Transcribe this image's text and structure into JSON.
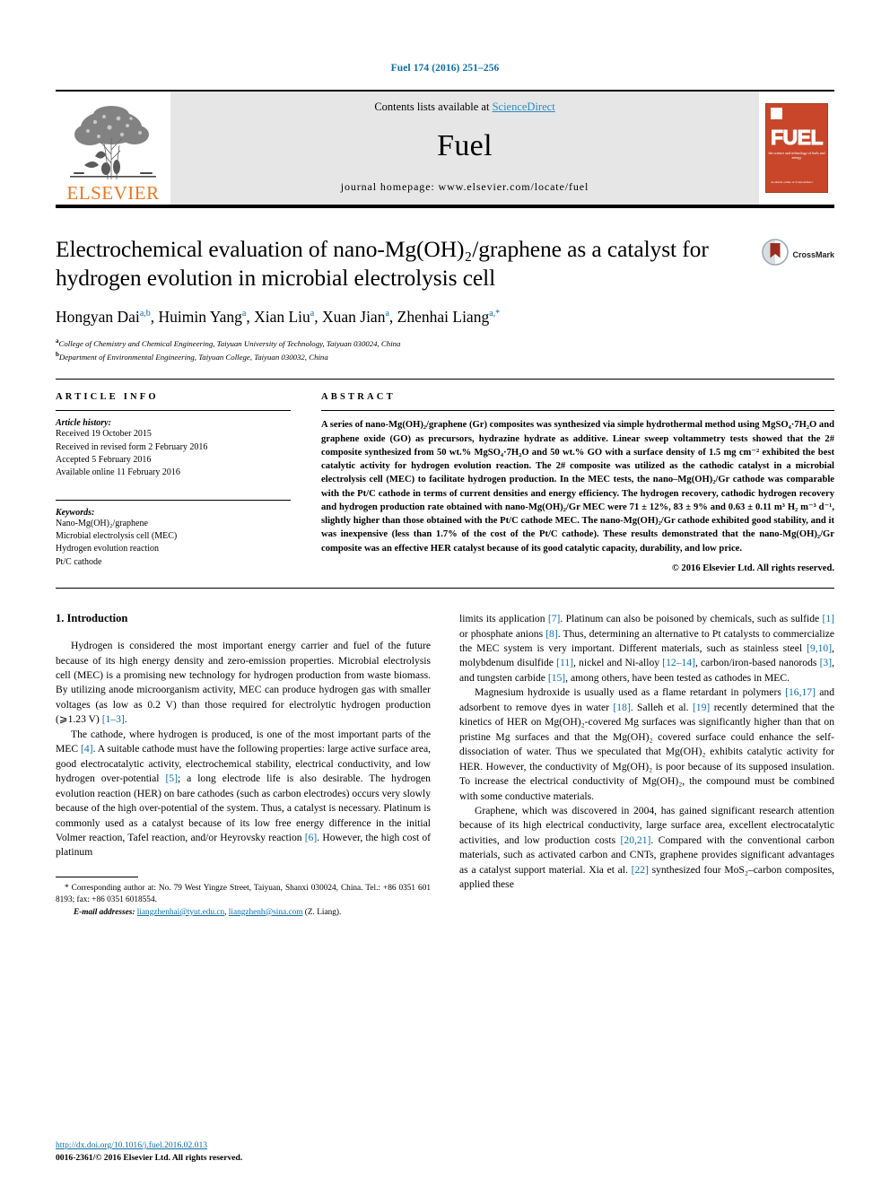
{
  "running_head": "Fuel 174 (2016) 251–256",
  "journal_header": {
    "contents_prefix": "Contents lists available at ",
    "sciencedirect": "ScienceDirect",
    "journal_name": "Fuel",
    "homepage": "journal homepage: www.elsevier.com/locate/fuel",
    "publisher_wordmark": "ELSEVIER",
    "publisher_logo_icon": "elsevier-tree-logo",
    "cover": {
      "wordmark": "FUEL",
      "subtitle": "the science and technology of fuels and energy",
      "bottom_text": "Available online at\nScienceDirect"
    }
  },
  "article": {
    "title": "Electrochemical evaluation of nano-Mg(OH)₂/graphene as a catalyst for hydrogen evolution in microbial electrolysis cell",
    "crossmark_label": "CrossMark",
    "authors": [
      {
        "name": "Hongyan Dai",
        "marks": "a,b"
      },
      {
        "name": "Huimin Yang",
        "marks": "a"
      },
      {
        "name": "Xian Liu",
        "marks": "a"
      },
      {
        "name": "Xuan Jian",
        "marks": "a"
      },
      {
        "name": "Zhenhai Liang",
        "marks": "a,*"
      }
    ],
    "affiliations": [
      {
        "mark": "a",
        "text": "College of Chemistry and Chemical Engineering, Taiyuan University of Technology, Taiyuan 030024, China"
      },
      {
        "mark": "b",
        "text": "Department of Environmental Engineering, Taiyuan College, Taiyuan 030032, China"
      }
    ]
  },
  "article_info": {
    "heading": "ARTICLE INFO",
    "history_label": "Article history:",
    "history": [
      "Received 19 October 2015",
      "Received in revised form 2 February 2016",
      "Accepted 5 February 2016",
      "Available online 11 February 2016"
    ],
    "keywords_label": "Keywords:",
    "keywords": [
      "Nano-Mg(OH)₂/graphene",
      "Microbial electrolysis cell (MEC)",
      "Hydrogen evolution reaction",
      "Pt/C cathode"
    ]
  },
  "abstract": {
    "heading": "ABSTRACT",
    "text": "A series of nano-Mg(OH)₂/graphene (Gr) composites was synthesized via simple hydrothermal method using MgSO₄·7H₂O and graphene oxide (GO) as precursors, hydrazine hydrate as additive. Linear sweep voltammetry tests showed that the 2# composite synthesized from 50 wt.% MgSO₄·7H₂O and 50 wt.% GO with a surface density of 1.5 mg cm⁻² exhibited the best catalytic activity for hydrogen evolution reaction. The 2# composite was utilized as the cathodic catalyst in a microbial electrolysis cell (MEC) to facilitate hydrogen production. In the MEC tests, the nano–Mg(OH)₂/Gr cathode was comparable with the Pt/C cathode in terms of current densities and energy efficiency. The hydrogen recovery, cathodic hydrogen recovery and hydrogen production rate obtained with nano-Mg(OH)₂/Gr MEC were 71 ± 12%, 83 ± 9% and 0.63 ± 0.11 m³ H₂ m⁻³ d⁻¹, slightly higher than those obtained with the Pt/C cathode MEC. The nano-Mg(OH)₂/Gr cathode exhibited good stability, and it was inexpensive (less than 1.7% of the cost of the Pt/C cathode). These results demonstrated that the nano-Mg(OH)₂/Gr composite was an effective HER catalyst because of its good catalytic capacity, durability, and low price.",
    "copyright": "© 2016 Elsevier Ltd. All rights reserved."
  },
  "body": {
    "section_heading": "1. Introduction",
    "left_paragraphs": [
      "Hydrogen is considered the most important energy carrier and fuel of the future because of its high energy density and zero-emission properties. Microbial electrolysis cell (MEC) is a promising new technology for hydrogen production from waste biomass. By utilizing anode microorganism activity, MEC can produce hydrogen gas with smaller voltages (as low as 0.2 V) than those required for electrolytic hydrogen production (⩾1.23 V) [1–3].",
      "The cathode, where hydrogen is produced, is one of the most important parts of the MEC [4]. A suitable cathode must have the following properties: large active surface area, good electrocatalytic activity, electrochemical stability, electrical conductivity, and low hydrogen over-potential [5]; a long electrode life is also desirable. The hydrogen evolution reaction (HER) on bare cathodes (such as carbon electrodes) occurs very slowly because of the high over-potential of the system. Thus, a catalyst is necessary. Platinum is commonly used as a catalyst because of its low free energy difference in the initial Volmer reaction, Tafel reaction, and/or Heyrovsky reaction [6]. However, the high cost of platinum"
    ],
    "right_paragraphs": [
      "limits its application [7]. Platinum can also be poisoned by chemicals, such as sulfide [1] or phosphate anions [8]. Thus, determining an alternative to Pt catalysts to commercialize the MEC system is very important. Different materials, such as stainless steel [9,10], molybdenum disulfide [11], nickel and Ni-alloy [12–14], carbon/iron-based nanorods [3], and tungsten carbide [15], among others, have been tested as cathodes in MEC.",
      "Magnesium hydroxide is usually used as a flame retardant in polymers [16,17] and adsorbent to remove dyes in water [18]. Salleh et al. [19] recently determined that the kinetics of HER on Mg(OH)₂-covered Mg surfaces was significantly higher than that on pristine Mg surfaces and that the Mg(OH)₂ covered surface could enhance the self-dissociation of water. Thus we speculated that Mg(OH)₂ exhibits catalytic activity for HER. However, the conductivity of Mg(OH)₂ is poor because of its supposed insulation. To increase the electrical conductivity of Mg(OH)₂, the compound must be combined with some conductive materials.",
      "Graphene, which was discovered in 2004, has gained significant research attention because of its high electrical conductivity, large surface area, excellent electrocatalytic activities, and low production costs [20,21]. Compared with the conventional carbon materials, such as activated carbon and CNTs, graphene provides significant advantages as a catalyst support material. Xia et al. [22] synthesized four MoS₂–carbon composites, applied these"
    ]
  },
  "footnote": {
    "star": "*",
    "corresponding": "Corresponding author at: No. 79 West Yingze Street, Taiyuan, Shanxi 030024, China. Tel.: +86 0351 601 8193; fax: +86 0351 6018554.",
    "email_label": "E-mail addresses:",
    "emails": [
      "liangzhenhai@tyut.edu.cn",
      "liangzhenh@sina.com"
    ],
    "email_suffix": "(Z. Liang)."
  },
  "page_footer": {
    "doi": "http://dx.doi.org/10.1016/j.fuel.2016.02.013",
    "issn_line": "0016-2361/© 2016 Elsevier Ltd. All rights reserved."
  },
  "colors": {
    "link_blue": "#0b6ea8",
    "elsevier_orange": "#E87722",
    "cover_red": "#c9462a",
    "band_grey": "#e6e6e6"
  }
}
